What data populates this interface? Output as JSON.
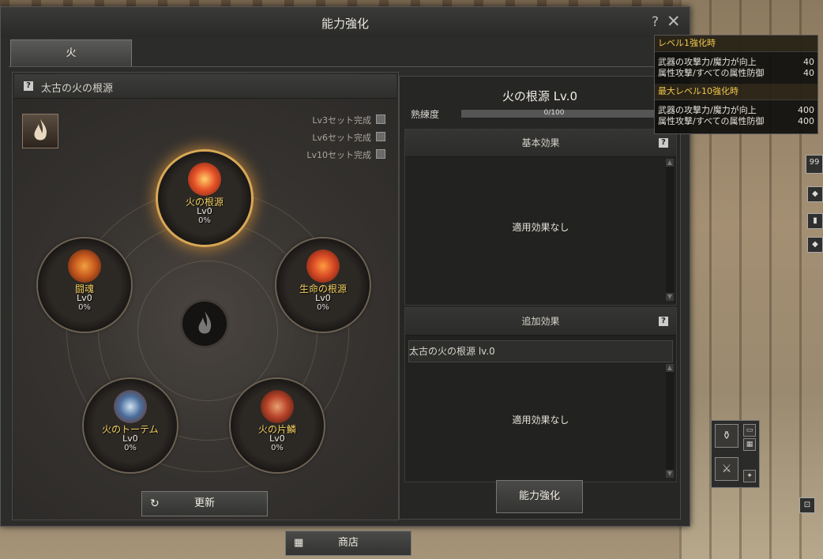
{
  "window": {
    "title": "能力強化",
    "help": "?",
    "close": "✕"
  },
  "tabs": [
    {
      "label": "火"
    }
  ],
  "left_panel": {
    "help": "?",
    "title": "太古の火の根源",
    "fire_icon": "flame-icon",
    "sets": [
      {
        "label": "Lv3セット完成"
      },
      {
        "label": "Lv6セット完成"
      },
      {
        "label": "Lv10セット完成"
      }
    ],
    "nodes": [
      {
        "name": "火の根源",
        "level": "Lv0",
        "percent": "0%",
        "color": "#e8542a"
      },
      {
        "name": "闘魂",
        "level": "Lv0",
        "percent": "0%",
        "color": "#c75a1f"
      },
      {
        "name": "生命の根源",
        "level": "Lv0",
        "percent": "0%",
        "color": "#d84a25"
      },
      {
        "name": "火のトーテム",
        "level": "Lv0",
        "percent": "0%",
        "color": "#4a6e9c"
      },
      {
        "name": "火の片鱗",
        "level": "Lv0",
        "percent": "0%",
        "color": "#b8442a"
      }
    ],
    "refresh_label": "更新"
  },
  "right_panel": {
    "title": "火の根源 Lv.0",
    "proficiency_label": "熟練度",
    "proficiency_text": "0/100",
    "proficiency_fraction": 0,
    "basic": {
      "header": "基本効果",
      "help": "?",
      "body": "適用効果なし"
    },
    "extra": {
      "header": "追加効果",
      "help": "?",
      "subheader": "太古の火の根源 lv.0",
      "body": "適用効果なし"
    },
    "enhance_label": "能力強化"
  },
  "shop_label": "商店",
  "tooltip": {
    "sections": [
      {
        "header": "レベル1強化時",
        "rows": [
          {
            "label": "武器の攻撃力/魔力が向上",
            "value": "40"
          },
          {
            "label": "属性攻撃/すべての属性防御",
            "value": "40"
          }
        ]
      },
      {
        "header": "最大レベル10強化時",
        "rows": [
          {
            "label": "武器の攻撃力/魔力が向上",
            "value": "400"
          },
          {
            "label": "属性攻撃/すべての属性防御",
            "value": "400"
          }
        ]
      }
    ]
  },
  "hud": {
    "side_badge": "99"
  },
  "colors": {
    "accent_gold": "#f1c84c",
    "node_glow": "#d8a855"
  }
}
